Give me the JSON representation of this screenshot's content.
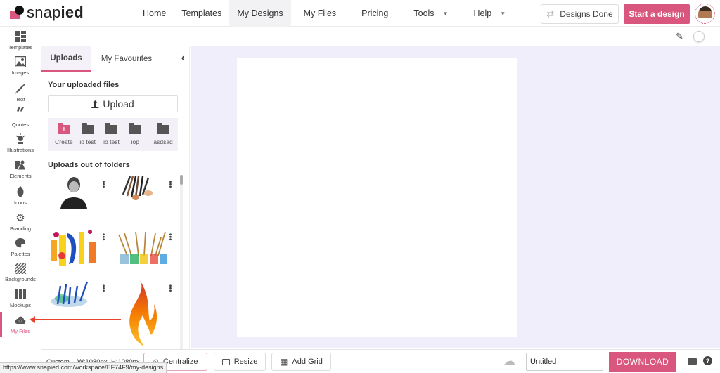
{
  "app": {
    "logo_text_light": "snap",
    "logo_text_bold": "ied",
    "brand_color": "#d9577f"
  },
  "nav": {
    "items": [
      {
        "label": "Home",
        "active": false,
        "dropdown": false
      },
      {
        "label": "Templates",
        "active": false,
        "dropdown": false
      },
      {
        "label": "My Designs",
        "active": true,
        "dropdown": false
      },
      {
        "label": "My Files",
        "active": false,
        "dropdown": false
      },
      {
        "label": "Pricing",
        "active": false,
        "dropdown": false
      },
      {
        "label": "Tools",
        "active": false,
        "dropdown": true
      },
      {
        "label": "Help",
        "active": false,
        "dropdown": true
      }
    ],
    "designs_done_label": "Designs Done",
    "start_design_label": "Start a design"
  },
  "sidebar": {
    "items": [
      {
        "label": "Templates",
        "icon": "templates-icon"
      },
      {
        "label": "Images",
        "icon": "images-icon"
      },
      {
        "label": "Text",
        "icon": "pen-nib-icon"
      },
      {
        "label": "Quotes",
        "icon": "quotes-icon"
      },
      {
        "label": "Illustrations",
        "icon": "illustrations-icon"
      },
      {
        "label": "Elements",
        "icon": "elements-icon"
      },
      {
        "label": "Icons",
        "icon": "leaf-icon"
      },
      {
        "label": "Branding",
        "icon": "gears-icon"
      },
      {
        "label": "Palettes",
        "icon": "palette-icon"
      },
      {
        "label": "Backgrounds",
        "icon": "backgrounds-icon"
      },
      {
        "label": "Mockups",
        "icon": "mockups-icon"
      },
      {
        "label": "My Files",
        "icon": "cloud-files-icon",
        "active": true
      }
    ]
  },
  "panel": {
    "tabs": [
      {
        "label": "Uploads",
        "active": true
      },
      {
        "label": "My Favourites",
        "active": false
      }
    ],
    "uploaded_title": "Your uploaded files",
    "upload_label": "Upload",
    "folders": [
      {
        "label": "Create",
        "type": "create"
      },
      {
        "label": "io test",
        "type": "folder"
      },
      {
        "label": "io test",
        "type": "folder"
      },
      {
        "label": "iop",
        "type": "folder"
      },
      {
        "label": "asdsad",
        "type": "folder"
      }
    ],
    "out_of_folders_title": "Uploads out of folders",
    "thumbnails": [
      {
        "name": "portrait-photo"
      },
      {
        "name": "makeup-brushes"
      },
      {
        "name": "paint-strokes"
      },
      {
        "name": "paint-cups-brushes"
      },
      {
        "name": "pencils-splash"
      },
      {
        "name": "flame-graphic"
      }
    ]
  },
  "bottom": {
    "size_preset": "Custom",
    "width_label": "W:1080px",
    "height_label": "H:1080px",
    "centralize_label": "Centralize",
    "resize_label": "Resize",
    "add_grid_label": "Add Grid",
    "title_value": "Untitled",
    "download_label": "DOWNLOAD"
  },
  "status_url": "https://www.snapied.com/workspace/EF74F9/my-designs"
}
